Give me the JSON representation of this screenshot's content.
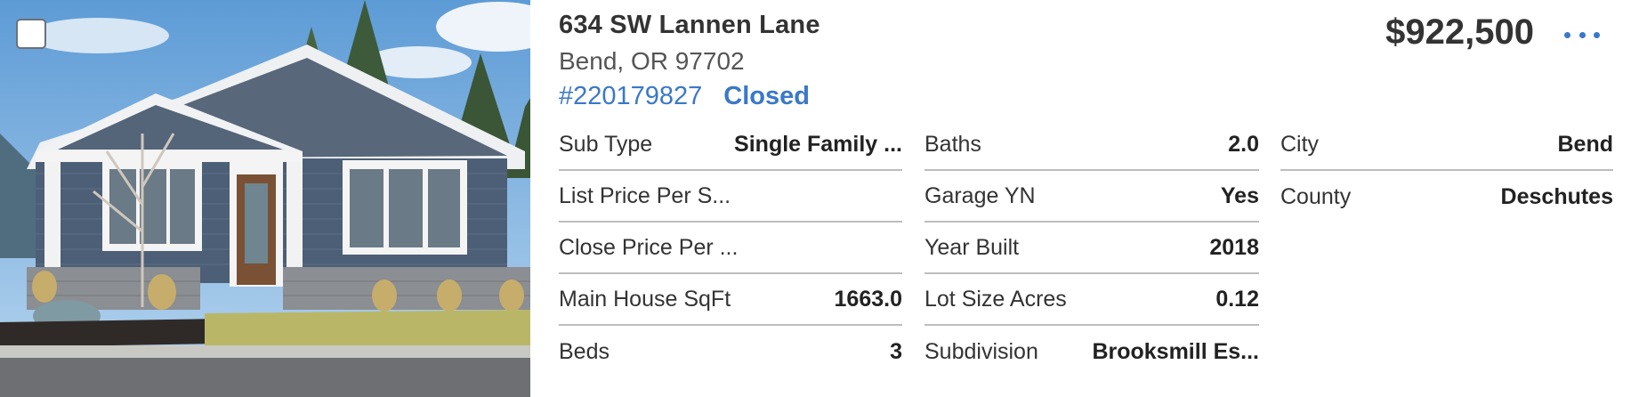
{
  "listing": {
    "address": "634 SW Lannen Lane",
    "city_state_zip": "Bend, OR 97702",
    "mls_number": "#220179827",
    "status": "Closed",
    "price": "$922,500",
    "photo_alt": "Gray single-story craftsman house with white trim"
  },
  "icons": {
    "select": "checkbox-icon",
    "more": "more-options-icon"
  },
  "colors": {
    "accent": "#3a78c9",
    "divider": "#bdbdbd"
  },
  "details": {
    "col1": [
      {
        "label": "Sub Type",
        "value": "Single Family ..."
      },
      {
        "label": "List Price Per S...",
        "value": ""
      },
      {
        "label": "Close Price Per ...",
        "value": ""
      },
      {
        "label": "Main House SqFt",
        "value": "1663.0"
      },
      {
        "label": "Beds",
        "value": "3"
      }
    ],
    "col2": [
      {
        "label": "Baths",
        "value": "2.0"
      },
      {
        "label": "Garage YN",
        "value": "Yes"
      },
      {
        "label": "Year Built",
        "value": "2018"
      },
      {
        "label": "Lot Size Acres",
        "value": "0.12"
      },
      {
        "label": "Subdivision",
        "value": "Brooksmill Es..."
      }
    ],
    "col3": [
      {
        "label": "City",
        "value": "Bend"
      },
      {
        "label": "County",
        "value": "Deschutes"
      }
    ]
  }
}
